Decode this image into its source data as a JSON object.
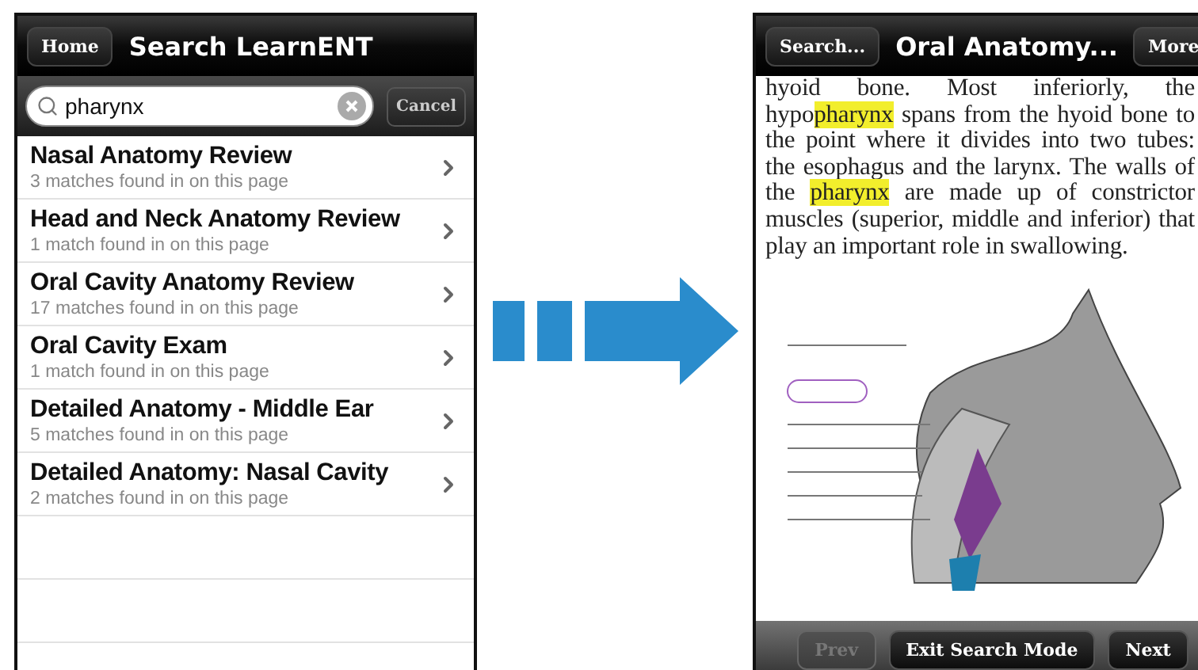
{
  "search_screen": {
    "nav": {
      "back_button": "Home",
      "title": "Search LearnENT"
    },
    "search": {
      "value": "pharynx",
      "cancel_button": "Cancel"
    },
    "results": [
      {
        "title": "Nasal Anatomy Review",
        "subtitle": "3 matches found in on this page"
      },
      {
        "title": "Head and Neck Anatomy Review",
        "subtitle": "1 match found in on this page"
      },
      {
        "title": "Oral Cavity Anatomy Review",
        "subtitle": "17 matches found in on this page"
      },
      {
        "title": "Oral Cavity Exam",
        "subtitle": "1 match found in on this page"
      },
      {
        "title": "Detailed Anatomy - Middle Ear",
        "subtitle": "5 matches found in on this page"
      },
      {
        "title": "Detailed Anatomy: Nasal Cavity",
        "subtitle": "2 matches found in on this page"
      }
    ]
  },
  "page_screen": {
    "nav": {
      "back_button": "Search...",
      "title": "Oral Anatomy...",
      "right_button": "More"
    },
    "paragraph": [
      {
        "text": "hyoid bone. Most inferiorly, the hypo",
        "highlighted": false
      },
      {
        "text": "pharynx",
        "highlighted": true
      },
      {
        "text": " spans from the hyoid bone to the point where it divides into two tubes: the esophagus and the larynx. The walls of the ",
        "highlighted": false
      },
      {
        "text": "pharynx",
        "highlighted": true
      },
      {
        "text": " are made up of constrictor muscles (superior, middle and inferior) that play an important role in swallowing.",
        "highlighted": false
      }
    ],
    "toolbar": [
      {
        "label": "Prev",
        "disabled": true
      },
      {
        "label": "Exit Search Mode",
        "disabled": false
      },
      {
        "label": "Next",
        "disabled": false
      }
    ]
  }
}
